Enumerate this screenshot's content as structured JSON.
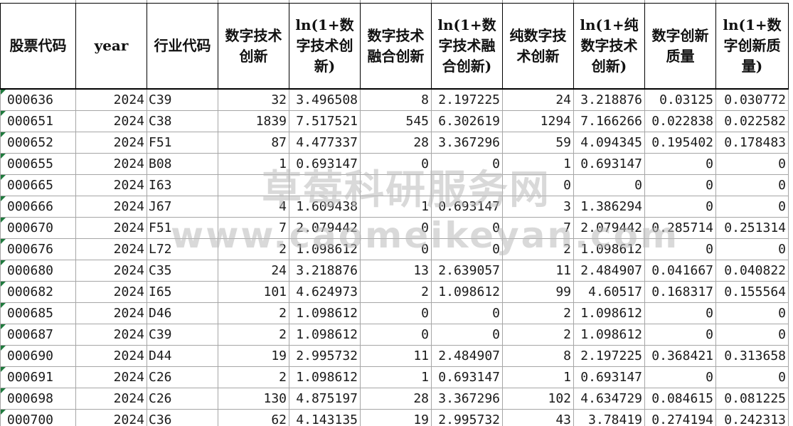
{
  "columns": [
    "股票代码",
    "year",
    "行业代码",
    "数字技术创新",
    "ln(1+数字技术创新)",
    "数字技术融合创新",
    "ln(1+数字技术融合创新)",
    "纯数字技术创新",
    "ln(1+纯数字技术创新)",
    "数字创新质量",
    "ln(1+数字创新质量)"
  ],
  "rows": [
    [
      "000636",
      "2024",
      "C39",
      "32",
      "3.496508",
      "8",
      "2.197225",
      "24",
      "3.218876",
      "0.03125",
      "0.030772"
    ],
    [
      "000651",
      "2024",
      "C38",
      "1839",
      "7.517521",
      "545",
      "6.302619",
      "1294",
      "7.166266",
      "0.022838",
      "0.022582"
    ],
    [
      "000652",
      "2024",
      "F51",
      "87",
      "4.477337",
      "28",
      "3.367296",
      "59",
      "4.094345",
      "0.195402",
      "0.178483"
    ],
    [
      "000655",
      "2024",
      "B08",
      "1",
      "0.693147",
      "0",
      "0",
      "1",
      "0.693147",
      "0",
      "0"
    ],
    [
      "000665",
      "2024",
      "I63",
      "",
      "",
      "",
      "",
      "0",
      "0",
      "0",
      "0"
    ],
    [
      "000666",
      "2024",
      "J67",
      "4",
      "1.609438",
      "1",
      "0.693147",
      "3",
      "1.386294",
      "0",
      "0"
    ],
    [
      "000670",
      "2024",
      "F51",
      "7",
      "2.079442",
      "0",
      "0",
      "7",
      "2.079442",
      "0.285714",
      "0.251314"
    ],
    [
      "000676",
      "2024",
      "L72",
      "2",
      "1.098612",
      "0",
      "0",
      "2",
      "1.098612",
      "0",
      "0"
    ],
    [
      "000680",
      "2024",
      "C35",
      "24",
      "3.218876",
      "13",
      "2.639057",
      "11",
      "2.484907",
      "0.041667",
      "0.040822"
    ],
    [
      "000682",
      "2024",
      "I65",
      "101",
      "4.624973",
      "2",
      "1.098612",
      "99",
      "4.60517",
      "0.168317",
      "0.155564"
    ],
    [
      "000685",
      "2024",
      "D46",
      "2",
      "1.098612",
      "0",
      "0",
      "2",
      "1.098612",
      "0",
      "0"
    ],
    [
      "000687",
      "2024",
      "C39",
      "2",
      "1.098612",
      "0",
      "0",
      "2",
      "1.098612",
      "0",
      "0"
    ],
    [
      "000690",
      "2024",
      "D44",
      "19",
      "2.995732",
      "11",
      "2.484907",
      "8",
      "2.197225",
      "0.368421",
      "0.313658"
    ],
    [
      "000691",
      "2024",
      "C26",
      "2",
      "1.098612",
      "1",
      "0.693147",
      "1",
      "0.693147",
      "0",
      "0"
    ],
    [
      "000698",
      "2024",
      "C26",
      "130",
      "4.875197",
      "28",
      "3.367296",
      "102",
      "4.634729",
      "0.084615",
      "0.081225"
    ],
    [
      "000700",
      "2024",
      "C36",
      "62",
      "4.143135",
      "19",
      "2.995732",
      "43",
      "3.78419",
      "0.274194",
      "0.242313"
    ]
  ],
  "watermark": {
    "line1": "草莓科研服务网",
    "line2": "www.caomeikeyan.com"
  },
  "colors": {
    "grid": "#a6a6a6",
    "header_border": "#000000",
    "text_marker": "#1f7a3d"
  }
}
